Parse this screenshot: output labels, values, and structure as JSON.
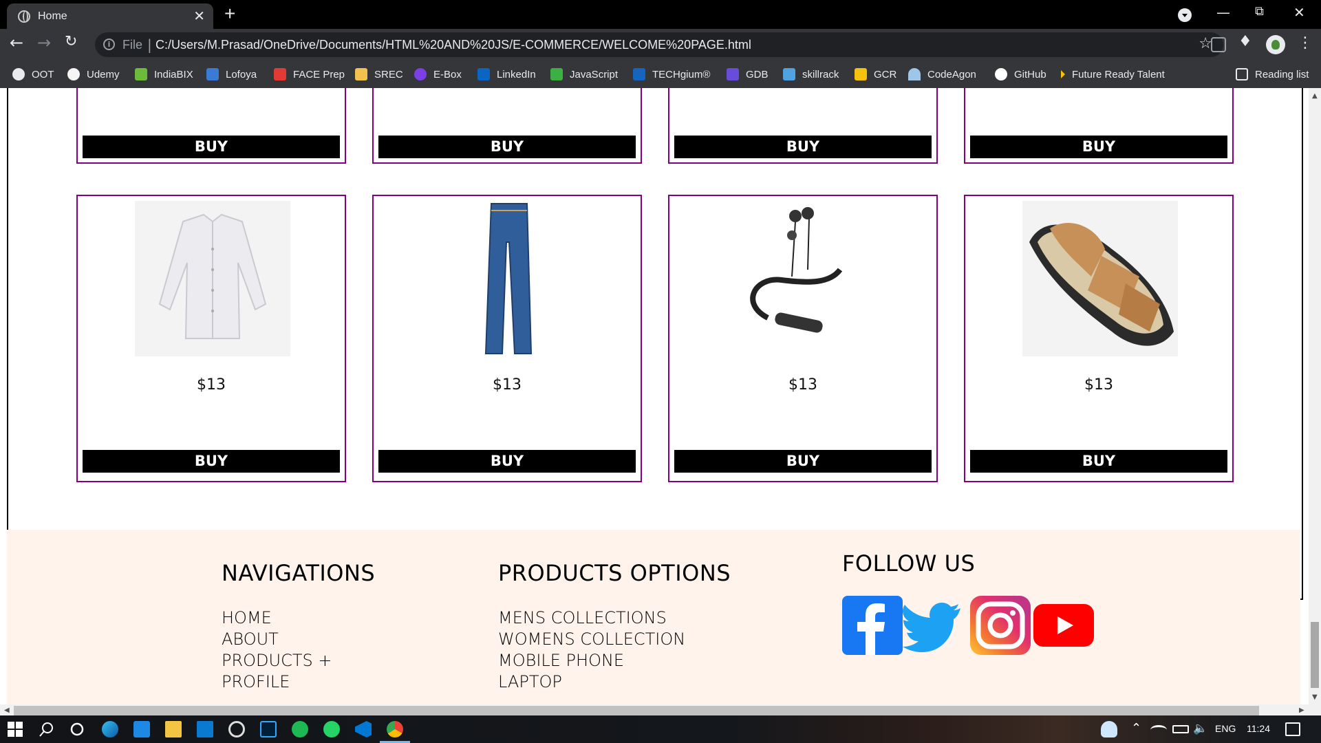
{
  "browser": {
    "tab_title": "Home",
    "new_tab_symbol": "+",
    "close_symbol": "✕",
    "address_scheme": "File",
    "address_url": "C:/Users/M.Prasad/OneDrive/Documents/HTML%20AND%20JS/E-COMMERCE/WELCOME%20PAGE.html",
    "reading_list": "Reading list"
  },
  "bookmarks": [
    {
      "label": "OOT",
      "color": "#e8eaed"
    },
    {
      "label": "Udemy",
      "color": "#f5f5f5"
    },
    {
      "label": "IndiaBIX",
      "color": "#6dbb3a"
    },
    {
      "label": "Lofoya",
      "color": "#3a7bd5"
    },
    {
      "label": "FACE Prep",
      "color": "#e53935"
    },
    {
      "label": "SREC",
      "color": "#f2c14e"
    },
    {
      "label": "E-Box",
      "color": "#7b3fe4"
    },
    {
      "label": "LinkedIn",
      "color": "#0a66c2"
    },
    {
      "label": "JavaScript",
      "color": "#3cb043"
    },
    {
      "label": "TECHgium®",
      "color": "#1565c0"
    },
    {
      "label": "GDB",
      "color": "#6a4cdb"
    },
    {
      "label": "skillrack",
      "color": "#4fa3e0"
    },
    {
      "label": "GCR",
      "color": "#f4c20d"
    },
    {
      "label": "CodeAgon",
      "color": "#9ec6e8"
    },
    {
      "label": "GitHub",
      "color": "#ffffff"
    },
    {
      "label": "Future Ready Talent",
      "color": "#f5c400"
    }
  ],
  "products": {
    "top_row_buy": [
      "BUY",
      "BUY",
      "BUY",
      "BUY"
    ],
    "items": [
      {
        "name": "shirt",
        "price": "$13",
        "buy": "BUY"
      },
      {
        "name": "jeans",
        "price": "$13",
        "buy": "BUY"
      },
      {
        "name": "earphones",
        "price": "$13",
        "buy": "BUY"
      },
      {
        "name": "sandal",
        "price": "$13",
        "buy": "BUY"
      }
    ]
  },
  "footer": {
    "nav_title": "NAVIGATIONS",
    "nav_links": [
      "HOME",
      "ABOUT",
      "PRODUCTS +",
      "PROFILE"
    ],
    "prod_title": "PRODUCTS OPTIONS",
    "prod_links": [
      "MENS COLLECTIONS",
      "WOMENS COLLECTION",
      "MOBILE PHONE",
      "LAPTOP"
    ],
    "follow_title": "FOLLOW US",
    "social": [
      "facebook-icon",
      "twitter-icon",
      "instagram-icon",
      "youtube-icon"
    ]
  },
  "taskbar": {
    "lang": "ENG",
    "time": "11:24"
  },
  "colors": {
    "card_border": "#800080",
    "footer_bg": "#fff3ec",
    "buy_bg": "#000000"
  }
}
